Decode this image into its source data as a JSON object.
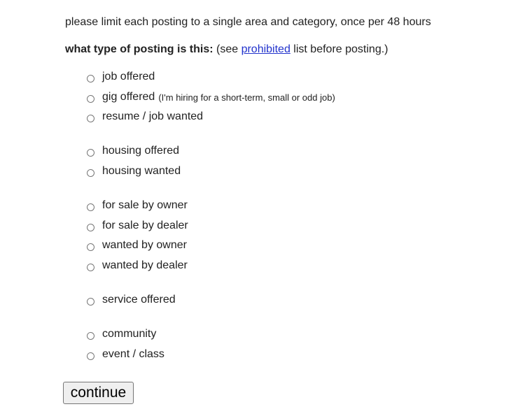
{
  "notice": "please limit each posting to a single area and category, once per 48 hours",
  "question": {
    "label": "what type of posting is this:",
    "pre_link": " (see ",
    "link": "prohibited",
    "post_link": " list before posting.)"
  },
  "options": [
    {
      "label": "job offered",
      "note": ""
    },
    {
      "label": "gig offered",
      "note": "(I'm hiring for a short-term, small or odd job)"
    },
    {
      "label": "resume / job wanted",
      "note": ""
    },
    {
      "label": "housing offered",
      "note": ""
    },
    {
      "label": "housing wanted",
      "note": ""
    },
    {
      "label": "for sale by owner",
      "note": ""
    },
    {
      "label": "for sale by dealer",
      "note": ""
    },
    {
      "label": "wanted by owner",
      "note": ""
    },
    {
      "label": "wanted by dealer",
      "note": ""
    },
    {
      "label": "service offered",
      "note": ""
    },
    {
      "label": "community",
      "note": ""
    },
    {
      "label": "event / class",
      "note": ""
    }
  ],
  "continue_label": "continue"
}
